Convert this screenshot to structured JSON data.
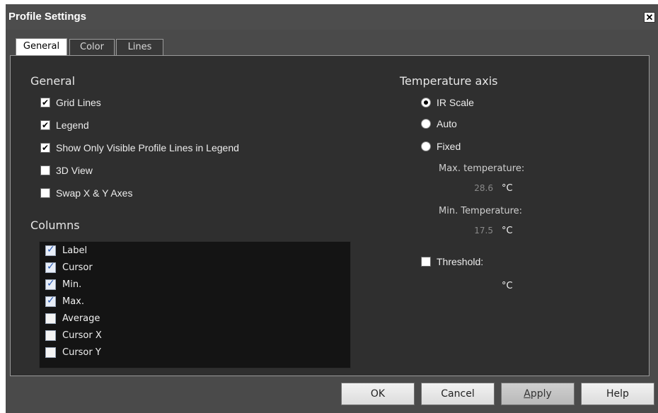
{
  "window": {
    "title": "Profile Settings",
    "close_glyph": "✕"
  },
  "tabs": [
    {
      "label": "General",
      "active": true
    },
    {
      "label": "Color",
      "active": false
    },
    {
      "label": "Lines",
      "active": false
    }
  ],
  "general": {
    "heading": "General",
    "options": [
      {
        "label": "Grid Lines",
        "checked": true
      },
      {
        "label": "Legend",
        "checked": true
      },
      {
        "label": "Show Only Visible Profile Lines in Legend",
        "checked": true
      },
      {
        "label": "3D View",
        "checked": false
      },
      {
        "label": "Swap X & Y Axes",
        "checked": false
      }
    ]
  },
  "columns": {
    "heading": "Columns",
    "items": [
      {
        "label": "Label",
        "checked": true
      },
      {
        "label": "Cursor",
        "checked": true
      },
      {
        "label": "Min.",
        "checked": true
      },
      {
        "label": "Max.",
        "checked": true
      },
      {
        "label": "Average",
        "checked": false
      },
      {
        "label": "Cursor X",
        "checked": false
      },
      {
        "label": "Cursor Y",
        "checked": false
      }
    ]
  },
  "temperature_axis": {
    "heading": "Temperature axis",
    "radios": [
      {
        "label": "IR Scale",
        "selected": true
      },
      {
        "label": "Auto",
        "selected": false
      },
      {
        "label": "Fixed",
        "selected": false
      }
    ],
    "max_label": "Max. temperature:",
    "max_value": "28.6",
    "min_label": "Min. Temperature:",
    "min_value": "17.5",
    "unit": "°C",
    "threshold_label": "Threshold:",
    "threshold_checked": false,
    "threshold_unit": "°C"
  },
  "buttons": {
    "ok": "OK",
    "cancel": "Cancel",
    "apply_prefix": "A",
    "apply_rest": "pply",
    "help": "Help"
  },
  "colors": {
    "panel_bg": "#2f2f2f",
    "dialog_bg": "#4a4a4a",
    "listbox_bg": "#141414",
    "check_accent": "#2b5cb5"
  }
}
